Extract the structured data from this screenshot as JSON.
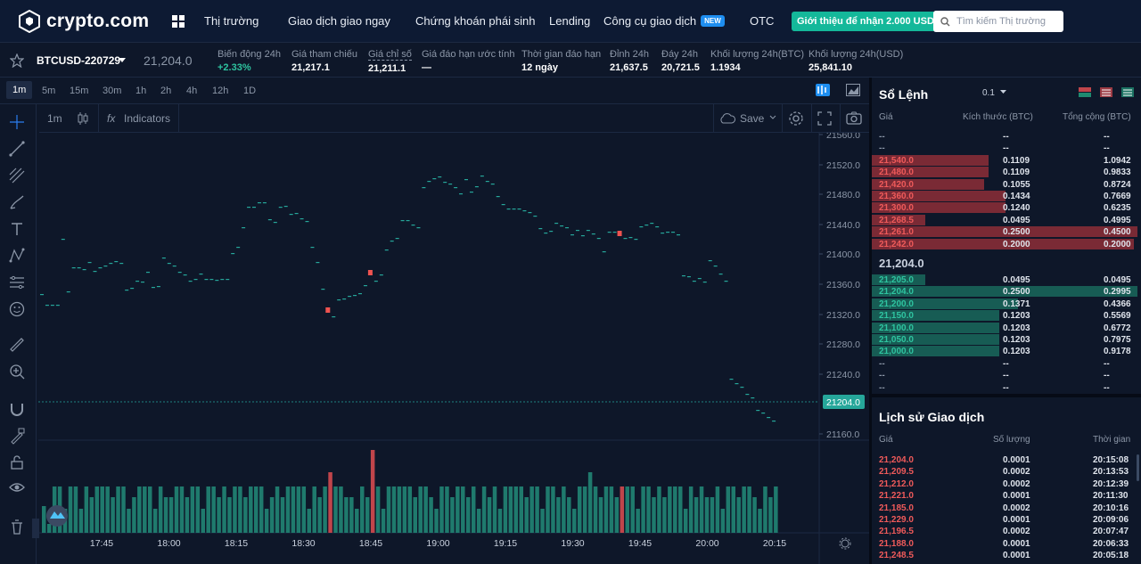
{
  "brand": {
    "name": "crypto.com"
  },
  "nav": {
    "items": [
      "Thị trường",
      "Giao dịch giao ngay",
      "Chứng khoán phái sinh",
      "Lending",
      "Công cụ giao dịch",
      "OTC"
    ],
    "new_badge": "NEW",
    "promo": "Giới thiệu để nhận 2.000 USD",
    "search_placeholder": "Tìm kiếm Thị trường"
  },
  "ticker": {
    "symbol": "BTCUSD-220729",
    "price": "21,204.0",
    "stats": [
      {
        "label": "Biến động 24h",
        "value": "+2.33%"
      },
      {
        "label": "Giá tham chiếu",
        "value": "21,217.1"
      },
      {
        "label": "Giá chỉ số",
        "value": "21,211.1"
      },
      {
        "label": "Giá đáo hạn ước tính",
        "value": "—"
      },
      {
        "label": "Thời gian đáo hạn",
        "value": "12 ngày"
      },
      {
        "label": "Đỉnh 24h",
        "value": "21,637.5"
      },
      {
        "label": "Đáy 24h",
        "value": "20,721.5"
      },
      {
        "label": "Khối lượng 24h(BTC)",
        "value": "1.1934"
      },
      {
        "label": "Khối lượng 24h(USD)",
        "value": "25,841.10"
      }
    ]
  },
  "timeframes": [
    "1m",
    "5m",
    "15m",
    "30m",
    "1h",
    "2h",
    "4h",
    "12h",
    "1D"
  ],
  "chartbar": {
    "interval": "1m",
    "indicators": "Indicators",
    "save": "Save"
  },
  "chart_data": {
    "type": "candlestick",
    "y_ticks": [
      "21560.0",
      "21520.0",
      "21480.0",
      "21440.0",
      "21400.0",
      "21360.0",
      "21320.0",
      "21280.0",
      "21240.0",
      "21204.0",
      "21160.0"
    ],
    "x_ticks": [
      "17:45",
      "18:00",
      "18:15",
      "18:30",
      "18:45",
      "19:00",
      "19:15",
      "19:30",
      "19:45",
      "20:00",
      "20:15"
    ],
    "last_price": "21204.0",
    "up_color": "#26a69a",
    "down_color": "#ef5350"
  },
  "orderbook": {
    "title": "Sổ Lệnh",
    "step": "0.1",
    "cols": [
      "Giá",
      "Kích thước (BTC)",
      "Tổng cộng (BTC)"
    ],
    "asks": [
      [
        "--",
        "--",
        "--"
      ],
      [
        "--",
        "--",
        "--"
      ],
      [
        "21,540.0",
        "0.1109",
        "1.0942"
      ],
      [
        "21,480.0",
        "0.1109",
        "0.9833"
      ],
      [
        "21,420.0",
        "0.1055",
        "0.8724"
      ],
      [
        "21,360.0",
        "0.1434",
        "0.7669"
      ],
      [
        "21,300.0",
        "0.1240",
        "0.6235"
      ],
      [
        "21,268.5",
        "0.0495",
        "0.4995"
      ],
      [
        "21,261.0",
        "0.2500",
        "0.4500"
      ],
      [
        "21,242.0",
        "0.2000",
        "0.2000"
      ]
    ],
    "mid": "21,204.0",
    "bids": [
      [
        "21,205.0",
        "0.0495",
        "0.0495"
      ],
      [
        "21,204.0",
        "0.2500",
        "0.2995"
      ],
      [
        "21,200.0",
        "0.1371",
        "0.4366"
      ],
      [
        "21,150.0",
        "0.1203",
        "0.5569"
      ],
      [
        "21,100.0",
        "0.1203",
        "0.6772"
      ],
      [
        "21,050.0",
        "0.1203",
        "0.7975"
      ],
      [
        "21,000.0",
        "0.1203",
        "0.9178"
      ],
      [
        "--",
        "--",
        "--"
      ],
      [
        "--",
        "--",
        "--"
      ],
      [
        "--",
        "--",
        "--"
      ]
    ]
  },
  "trades": {
    "title": "Lịch sử Giao dịch",
    "cols": [
      "Giá",
      "Số lượng",
      "Thời gian"
    ],
    "rows": [
      [
        "21,204.0",
        "0.0001",
        "20:15:08"
      ],
      [
        "21,209.5",
        "0.0002",
        "20:13:53"
      ],
      [
        "21,212.0",
        "0.0002",
        "20:12:39"
      ],
      [
        "21,221.0",
        "0.0001",
        "20:11:30"
      ],
      [
        "21,185.0",
        "0.0002",
        "20:10:16"
      ],
      [
        "21,229.0",
        "0.0001",
        "20:09:06"
      ],
      [
        "21,196.5",
        "0.0002",
        "20:07:47"
      ],
      [
        "21,188.0",
        "0.0001",
        "20:06:33"
      ],
      [
        "21,248.5",
        "0.0001",
        "20:05:18"
      ]
    ]
  }
}
